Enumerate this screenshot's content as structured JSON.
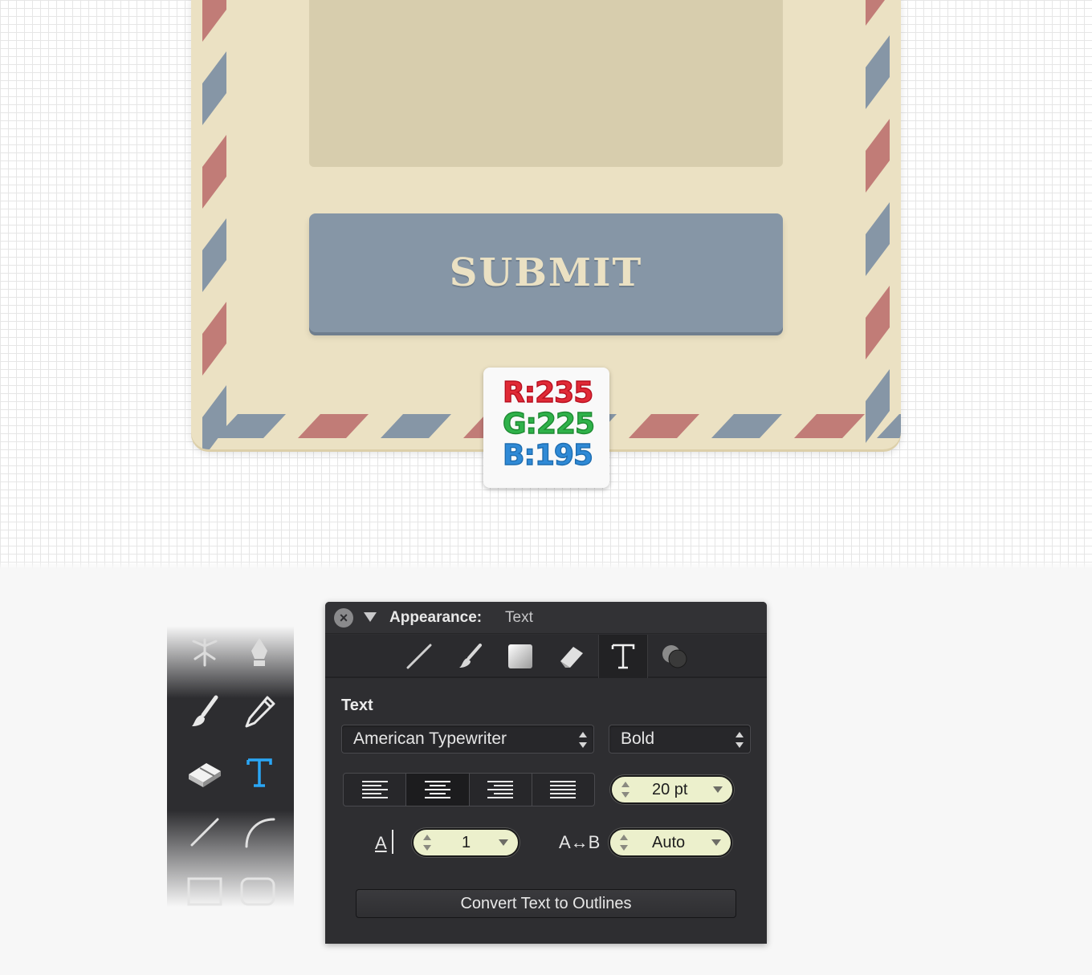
{
  "envelope": {
    "submit_label": "SUBMIT",
    "colors": {
      "paper": "#ebe1c3",
      "photo_area": "#d7cdad",
      "button": "#8696a6",
      "stripe_red": "#c17c77",
      "stripe_blue": "#8696a6"
    }
  },
  "color_badge": {
    "r": "R:235",
    "g": "G:225",
    "b": "B:195"
  },
  "tools": {
    "icons": [
      "lasso-icon",
      "pen-icon",
      "brush-icon",
      "pencil-icon",
      "eraser-icon",
      "text-tool-icon",
      "line-icon",
      "arc-icon",
      "rectangle-icon",
      "rounded-rectangle-icon"
    ],
    "active": "text-tool-icon",
    "accent": "#2aa6f5"
  },
  "panel": {
    "title": "Appearance:",
    "subtitle": "Text",
    "tabs": [
      "stroke-tab-icon",
      "brush-tab-icon",
      "fill-tab-icon",
      "eraser-tab-icon",
      "text-tab-icon",
      "effects-tab-icon"
    ],
    "active_tab": "text-tab-icon",
    "section_label": "Text",
    "font_family": "American Typewriter",
    "font_style": "Bold",
    "alignment_options": [
      "left",
      "center",
      "right",
      "justify"
    ],
    "active_alignment": "center",
    "font_size": "20 pt",
    "baseline_label": "A",
    "line_spacing": "1",
    "tracking_label": "A↔B",
    "tracking": "Auto",
    "convert_button": "Convert Text to Outlines"
  }
}
